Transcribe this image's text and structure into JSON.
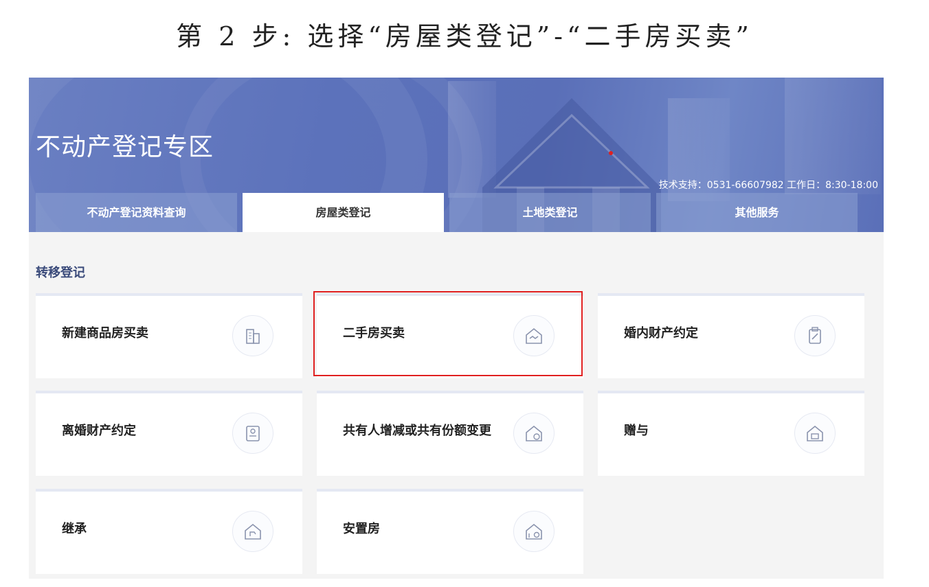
{
  "instruction": "第 2 步:  选择“房屋类登记”-“二手房买卖”",
  "banner": {
    "title": "不动产登记专区",
    "support": "技术支持：0531-66607982 工作日：8:30-18:00"
  },
  "tabs": [
    {
      "label": "不动产登记资料查询",
      "active": false
    },
    {
      "label": "房屋类登记",
      "active": true
    },
    {
      "label": "土地类登记",
      "active": false
    },
    {
      "label": "其他服务",
      "active": false
    }
  ],
  "section": {
    "title": "转移登记"
  },
  "cards": [
    {
      "label": "新建商品房买卖",
      "icon": "building-icon"
    },
    {
      "label": "二手房买卖",
      "icon": "house-handshake-icon",
      "highlighted": true
    },
    {
      "label": "婚内财产约定",
      "icon": "clipboard-edit-icon"
    },
    {
      "label": "离婚财产约定",
      "icon": "document-edit-icon"
    },
    {
      "label": "共有人增减或共有份额变更",
      "icon": "house-share-icon"
    },
    {
      "label": "赠与",
      "icon": "house-gift-icon"
    },
    {
      "label": "继承",
      "icon": "house-inherit-icon"
    },
    {
      "label": "安置房",
      "icon": "house-settle-icon"
    }
  ],
  "colors": {
    "banner": "#5c72bb",
    "highlight": "#e02020",
    "section_title": "#3a4a7a"
  }
}
